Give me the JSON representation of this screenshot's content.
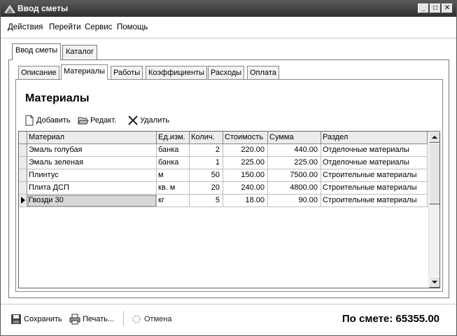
{
  "window": {
    "title": "Ввод сметы"
  },
  "menu": [
    "Действия",
    "Перейти",
    "Сервис",
    "Помощь"
  ],
  "outer_tabs": [
    "Ввод сметы",
    "Каталог"
  ],
  "inner_tabs": [
    "Описание",
    "Материалы",
    "Работы",
    "Коэффициенты",
    "Расходы",
    "Оплата"
  ],
  "section": {
    "title": "Материалы"
  },
  "toolbar": {
    "add": "Добавить",
    "edit": "Редакт.",
    "delete": "Удалить"
  },
  "grid": {
    "columns": [
      "Материал",
      "Ед.изм.",
      "Колич.",
      "Стоимость",
      "Сумма",
      "Раздел"
    ],
    "rows": [
      [
        "Эмаль голубая",
        "банка",
        "2",
        "220.00",
        "440.00",
        "Отделочные материалы"
      ],
      [
        "Эмаль зеленая",
        "банка",
        "1",
        "225.00",
        "225.00",
        "Отделочные материалы"
      ],
      [
        "Плинтус",
        "м",
        "50",
        "150.00",
        "7500.00",
        "Строительные материалы"
      ],
      [
        "Плита ДСП",
        "кв. м",
        "20",
        "240.00",
        "4800.00",
        "Строительные материалы"
      ],
      [
        "Гвозди 30",
        "кг",
        "5",
        "18.00",
        "90.00",
        "Строительные материалы"
      ]
    ],
    "selected_row": 4
  },
  "footer": {
    "save": "Сохранить",
    "print": "Печать...",
    "cancel": "Отмена",
    "total": "По смете: 65355.00"
  },
  "colors": {
    "titlebar": "#3c3c3c",
    "panel": "#ffffff",
    "header": "#ececec"
  }
}
